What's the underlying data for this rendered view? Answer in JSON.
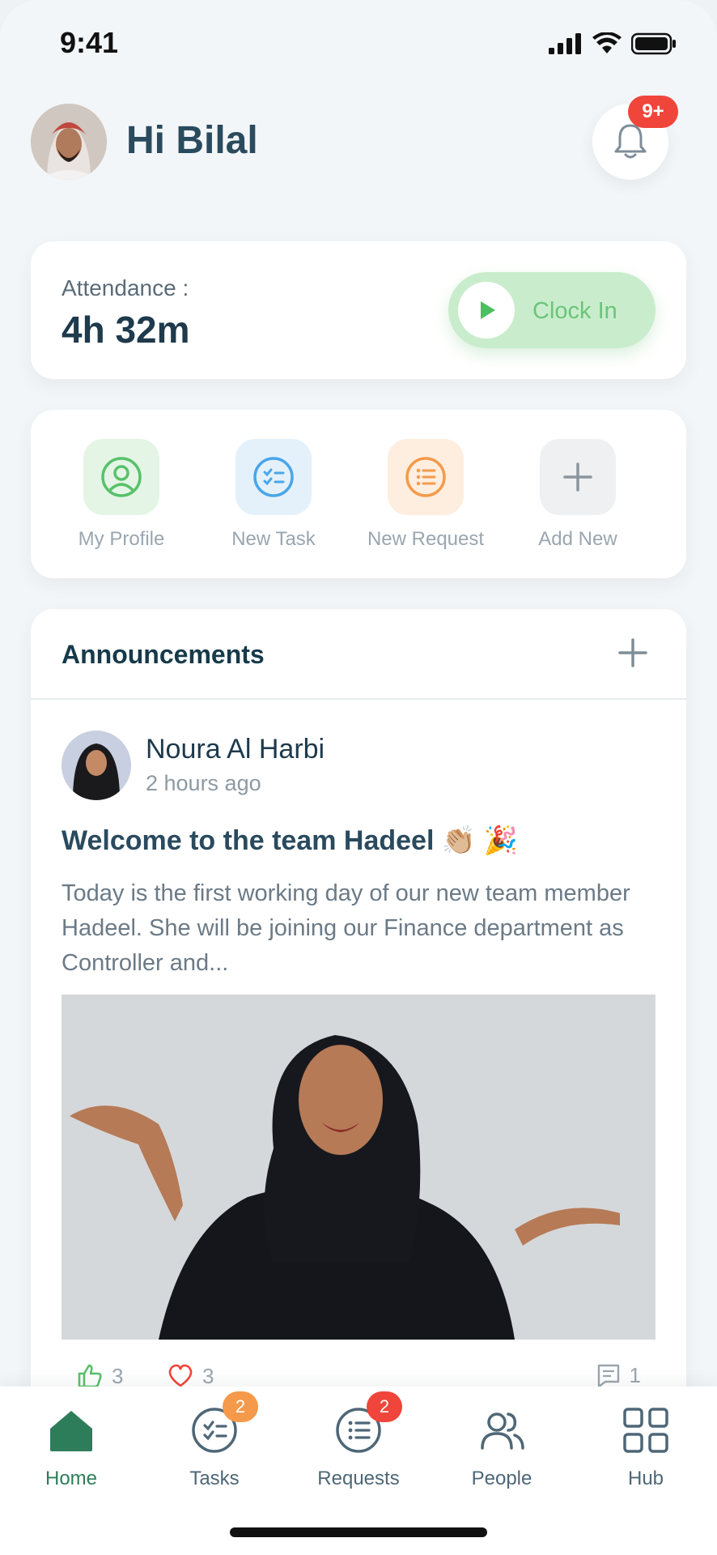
{
  "status_bar": {
    "time": "9:41"
  },
  "header": {
    "greeting": "Hi Bilal",
    "notification_badge": "9+"
  },
  "attendance": {
    "label": "Attendance :",
    "value": "4h 32m",
    "clock_in_label": "Clock In"
  },
  "quick_actions": [
    {
      "label": "My Profile",
      "icon": "profile-icon",
      "color": "#58c16a",
      "bg": "#e4f5e6"
    },
    {
      "label": "New Task",
      "icon": "task-list-icon",
      "color": "#49a6e8",
      "bg": "#e4f1fb"
    },
    {
      "label": "New Request",
      "icon": "request-list-icon",
      "color": "#f59a4a",
      "bg": "#fdeee0"
    },
    {
      "label": "Add New",
      "icon": "plus-icon",
      "color": "#8b959c",
      "bg": "#eef0f2"
    }
  ],
  "announcements": {
    "title": "Announcements",
    "post": {
      "author": "Noura Al Harbi",
      "time": "2 hours ago",
      "title": "Welcome to the team Hadeel 👏🏼 🎉",
      "body": "Today is the first working day of our new team member Hadeel. She will be joining our Finance department as Controller and...",
      "likes": "3",
      "hearts": "3",
      "comments": "1"
    }
  },
  "bottom_nav": [
    {
      "label": "Home",
      "icon": "home-icon",
      "active": true,
      "badge": ""
    },
    {
      "label": "Tasks",
      "icon": "tasks-icon",
      "active": false,
      "badge": "2",
      "badge_color": "#f59a4a"
    },
    {
      "label": "Requests",
      "icon": "requests-icon",
      "active": false,
      "badge": "2",
      "badge_color": "#f0453a"
    },
    {
      "label": "People",
      "icon": "people-icon",
      "active": false,
      "badge": ""
    },
    {
      "label": "Hub",
      "icon": "grid-icon",
      "active": false,
      "badge": ""
    }
  ],
  "colors": {
    "accent": "#2e7d5a",
    "clock_in_bg": "#c9edcc",
    "badge_red": "#f0453a"
  }
}
